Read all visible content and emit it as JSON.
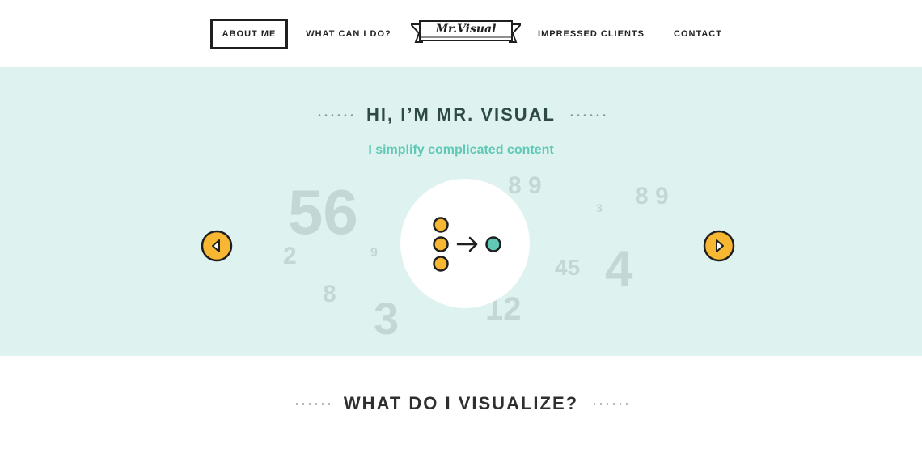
{
  "nav": {
    "items": [
      {
        "label": "ABOUT ME",
        "active": true
      },
      {
        "label": "WHAT CAN I DO?",
        "active": false
      },
      {
        "label": "IMPRESSED CLIENTS",
        "active": false
      },
      {
        "label": "CONTACT",
        "active": false
      }
    ],
    "logo": "Mr.Visual"
  },
  "hero": {
    "title": "HI, I’M MR. VISUAL",
    "subtitle": "I simplify complicated content",
    "background_numbers": [
      "56",
      "8 9",
      "8 9",
      "3",
      "2",
      "9",
      "45",
      "4",
      "8",
      "3",
      "12"
    ]
  },
  "section": {
    "title": "WHAT DO I VISUALIZE?"
  },
  "colors": {
    "accent_teal": "#5fc9b5",
    "hero_bg": "#def3f0",
    "arrow_yellow": "#f7b733",
    "number_grey": "#c3d8d4"
  },
  "icons": {
    "left_arrow": "chevron-left-icon",
    "right_arrow": "chevron-right-icon",
    "simplify": "three-dots-to-one-icon"
  }
}
